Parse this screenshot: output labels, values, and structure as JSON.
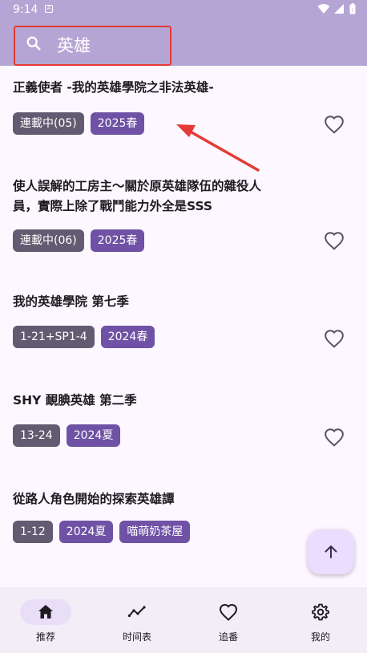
{
  "status_bar": {
    "time": "9:14",
    "app_icon": "A"
  },
  "search": {
    "value": "英雄",
    "icon": "search-icon"
  },
  "results": [
    {
      "title": "正義使者 -我的英雄學院之非法英雄-",
      "tags": [
        {
          "text": "連載中(05)",
          "style": "gray"
        },
        {
          "text": "2025春",
          "style": "purple"
        }
      ]
    },
    {
      "title": "使人誤解的工房主～關於原英雄隊伍的雜役人員，實際上除了戰鬥能力外全是SSS",
      "tags": [
        {
          "text": "連載中(06)",
          "style": "gray"
        },
        {
          "text": "2025春",
          "style": "purple"
        }
      ]
    },
    {
      "title": "我的英雄學院 第七季",
      "tags": [
        {
          "text": "1-21+SP1-4",
          "style": "gray"
        },
        {
          "text": "2024春",
          "style": "purple"
        }
      ]
    },
    {
      "title": "SHY 靦腆英雄 第二季",
      "tags": [
        {
          "text": "13-24",
          "style": "gray"
        },
        {
          "text": "2024夏",
          "style": "purple"
        }
      ]
    },
    {
      "title": "從路人角色開始的探索英雄譚",
      "tags": [
        {
          "text": "1-12",
          "style": "gray"
        },
        {
          "text": "2024夏",
          "style": "purple"
        },
        {
          "text": "喵萌奶茶屋",
          "style": "purple"
        }
      ]
    }
  ],
  "nav": [
    {
      "label": "推荐",
      "icon": "home-icon",
      "active": true
    },
    {
      "label": "时间表",
      "icon": "timeline-icon",
      "active": false
    },
    {
      "label": "追番",
      "icon": "heart-icon",
      "active": false
    },
    {
      "label": "我的",
      "icon": "settings-icon",
      "active": false
    }
  ],
  "colors": {
    "header": "#b4a5d4",
    "highlight_box": "#e53b36",
    "chip_gray": "#625b71",
    "chip_purple": "#6f52a5",
    "nav_bg": "#f3edf7"
  }
}
